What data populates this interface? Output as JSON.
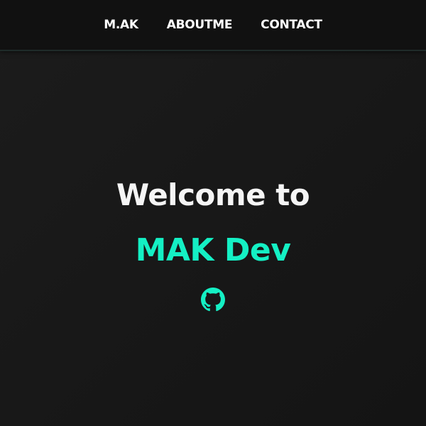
{
  "nav": {
    "items": [
      {
        "label": "M.AK"
      },
      {
        "label": "ABOUTME"
      },
      {
        "label": "CONTACT"
      }
    ]
  },
  "hero": {
    "title": "Welcome to",
    "brand": "MAK Dev",
    "social_icon": "github-icon"
  },
  "colors": {
    "accent": "#14f0c4",
    "background": "#171717",
    "navbar": "#111111",
    "text": "#f5f5f5"
  }
}
